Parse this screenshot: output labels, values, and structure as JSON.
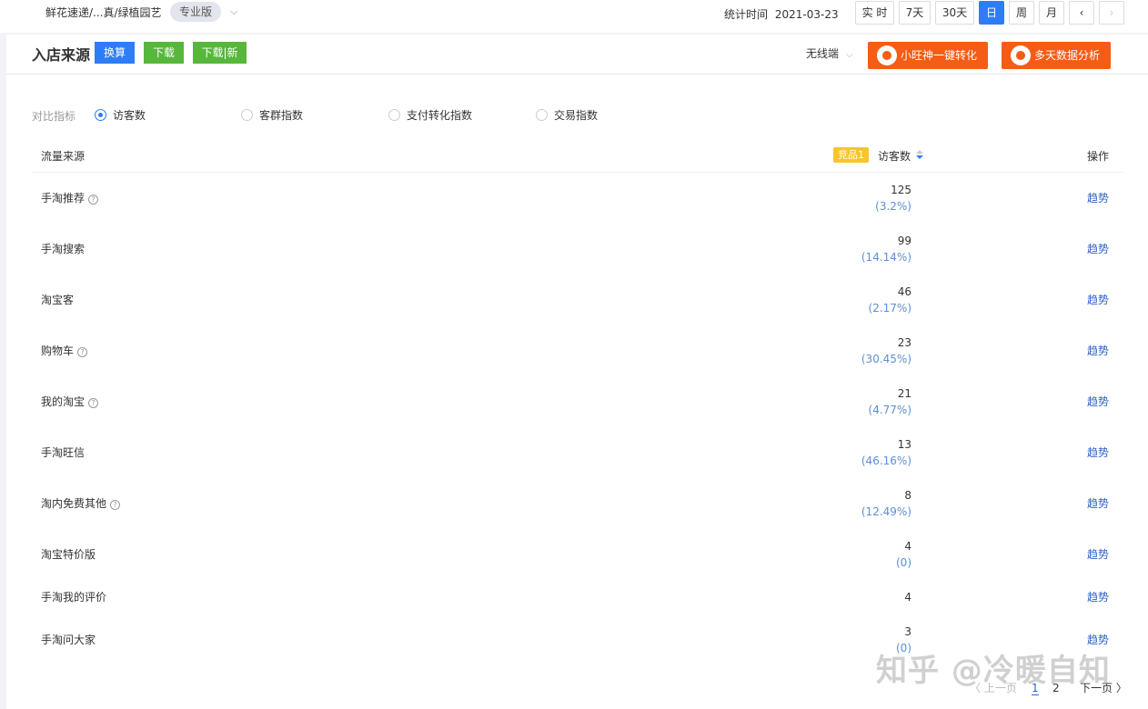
{
  "topbar": {
    "shop_path": "鲜花速递/...真/绿植园艺",
    "edition_badge": "专业版",
    "stat_time_label": "统计时间",
    "stat_date": "2021-03-23",
    "ranges": [
      "实 时",
      "7天",
      "30天",
      "日",
      "周",
      "月"
    ],
    "active_range": "日"
  },
  "panel": {
    "title": "入店来源",
    "btn_convert": "换算",
    "btn_download": "下载",
    "btn_download_new": "下载|新",
    "device": "无线端",
    "btn_xiaowang": "小旺神一键转化",
    "btn_multiday": "多天数据分析"
  },
  "compare": {
    "label": "对比指标",
    "options": [
      "访客数",
      "客群指数",
      "支付转化指数",
      "交易指数"
    ],
    "selected": "访客数"
  },
  "table": {
    "col_source": "流量来源",
    "badge": "竞品1",
    "col_visitors": "访客数",
    "col_op": "操作",
    "rows": [
      {
        "name": "手淘推荐",
        "help": true,
        "value": "125",
        "pct": "(3.2%)",
        "op": "趋势"
      },
      {
        "name": "手淘搜索",
        "help": false,
        "value": "99",
        "pct": "(14.14%)",
        "op": "趋势"
      },
      {
        "name": "淘宝客",
        "help": false,
        "value": "46",
        "pct": "(2.17%)",
        "op": "趋势"
      },
      {
        "name": "购物车",
        "help": true,
        "value": "23",
        "pct": "(30.45%)",
        "op": "趋势"
      },
      {
        "name": "我的淘宝",
        "help": true,
        "value": "21",
        "pct": "(4.77%)",
        "op": "趋势"
      },
      {
        "name": "手淘旺信",
        "help": false,
        "value": "13",
        "pct": "(46.16%)",
        "op": "趋势"
      },
      {
        "name": "淘内免费其他",
        "help": true,
        "value": "8",
        "pct": "(12.49%)",
        "op": "趋势"
      },
      {
        "name": "淘宝特价版",
        "help": false,
        "value": "4",
        "pct": "(0)",
        "op": "趋势"
      },
      {
        "name": "手淘我的评价",
        "help": false,
        "value": "4",
        "pct": "",
        "op": "趋势"
      },
      {
        "name": "手淘问大家",
        "help": false,
        "value": "3",
        "pct": "(0)",
        "op": "趋势"
      }
    ]
  },
  "pagination": {
    "prev": "〈 上一页",
    "pages": [
      "1",
      "2"
    ],
    "current": "1",
    "next": "下一页 〉"
  },
  "watermark": "知乎 @冷暖自知",
  "icons": {
    "help": "question-circle-icon",
    "chevron": "chevron-down-icon",
    "mascot": "mascot-icon"
  }
}
